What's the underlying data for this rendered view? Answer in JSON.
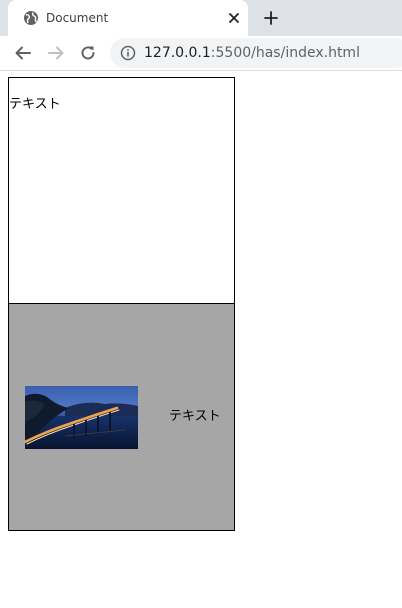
{
  "browser": {
    "tab": {
      "title": "Document"
    },
    "address_bar": {
      "host": "127.0.0.1",
      "path": ":5500/has/index.html"
    }
  },
  "page": {
    "top_box": {
      "text": "テキスト"
    },
    "bottom_box": {
      "text": "テキスト",
      "background": "#a6a6a6"
    }
  }
}
